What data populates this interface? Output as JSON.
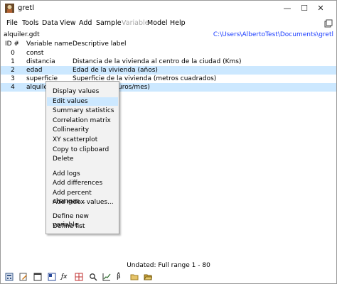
{
  "window": {
    "title": "gretl",
    "controls": {
      "minimize": "—",
      "maximize": "☐",
      "close": "✕"
    }
  },
  "menubar": {
    "items": [
      {
        "label": "File",
        "disabled": false
      },
      {
        "label": "Tools",
        "disabled": false
      },
      {
        "label": "Data",
        "disabled": false
      },
      {
        "label": "View",
        "disabled": false
      },
      {
        "label": "Add",
        "disabled": false
      },
      {
        "label": "Sample",
        "disabled": false
      },
      {
        "label": "Variable",
        "disabled": true
      },
      {
        "label": "Model",
        "disabled": false
      },
      {
        "label": "Help",
        "disabled": false
      }
    ]
  },
  "dataset": {
    "file_name": "alquiler.gdt",
    "path": "C:\\Users\\AlbertoTest\\Documents\\gretl"
  },
  "table": {
    "headers": {
      "id": "ID #",
      "name": "Variable name",
      "label": "Descriptive label"
    },
    "rows": [
      {
        "id": "0",
        "name": "const",
        "label": "",
        "selected": false
      },
      {
        "id": "1",
        "name": "distancia",
        "label": "Distancia de la vivienda al centro de la ciudad (Kms)",
        "selected": false
      },
      {
        "id": "2",
        "name": "edad",
        "label": "Edad de la vivienda (años)",
        "selected": true
      },
      {
        "id": "3",
        "name": "superficie",
        "label": "Superficie de la vivienda (metros cuadrados)",
        "selected": false
      },
      {
        "id": "4",
        "name": "alquiler",
        "label": "uros/mes)",
        "selected": true
      }
    ]
  },
  "context_menu": {
    "items": [
      {
        "label": "Display values"
      },
      {
        "label": "Edit values",
        "hover": true
      },
      {
        "label": "Summary statistics"
      },
      {
        "label": "Correlation matrix"
      },
      {
        "label": "Collinearity"
      },
      {
        "label": "XY scatterplot"
      },
      {
        "label": "Copy to clipboard"
      },
      {
        "label": "Delete"
      },
      {
        "label": "Add logs"
      },
      {
        "label": "Add differences"
      },
      {
        "label": "Add percent changes..."
      },
      {
        "label": "Add index values..."
      },
      {
        "label": "Define new variable..."
      },
      {
        "label": "Define list"
      }
    ]
  },
  "status": {
    "text": "Undated: Full range 1 - 80"
  },
  "bottom_toolbar": {
    "icons": [
      {
        "name": "calculator-icon",
        "glyph": "▦",
        "color": "#3a5a8a"
      },
      {
        "name": "script-editor-icon",
        "glyph": "✎",
        "color": "#d07a1a"
      },
      {
        "name": "terminal-icon",
        "glyph": "▣",
        "color": "#333333"
      },
      {
        "name": "session-icon-view-icon",
        "glyph": "▤",
        "color": "#2a4a9a"
      },
      {
        "name": "function-icon",
        "glyph": "ƒx",
        "color": "#222222"
      },
      {
        "name": "matrix-icon",
        "glyph": "⊞",
        "color": "#c03030"
      },
      {
        "name": "search-icon",
        "glyph": "⌕",
        "color": "#333333"
      },
      {
        "name": "graph-icon",
        "glyph": "⟋",
        "color": "#2a6a2a"
      },
      {
        "name": "model-icon",
        "glyph": "β̂",
        "color": "#222222"
      },
      {
        "name": "open-dataset-icon",
        "glyph": "▬",
        "color": "#c9a23a"
      },
      {
        "name": "folder-icon",
        "glyph": "▰",
        "color": "#c9a23a"
      }
    ]
  }
}
